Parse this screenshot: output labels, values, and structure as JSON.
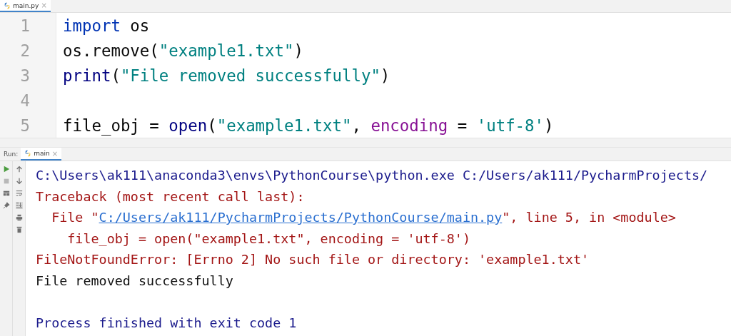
{
  "editor": {
    "tabs": [
      {
        "label": "main.py",
        "selected": true,
        "close": "×"
      }
    ],
    "lines": [
      {
        "number": "1",
        "tokens": [
          {
            "kind": "keyword",
            "text": "import"
          },
          {
            "kind": "plain",
            "text": " os"
          }
        ]
      },
      {
        "number": "2",
        "tokens": [
          {
            "kind": "plain",
            "text": "os.remove("
          },
          {
            "kind": "string",
            "text": "\"example1.txt\""
          },
          {
            "kind": "plain",
            "text": ")"
          }
        ]
      },
      {
        "number": "3",
        "tokens": [
          {
            "kind": "builtin",
            "text": "print"
          },
          {
            "kind": "plain",
            "text": "("
          },
          {
            "kind": "string",
            "text": "\"File removed successfully\""
          },
          {
            "kind": "plain",
            "text": ")"
          }
        ]
      },
      {
        "number": "4"
      },
      {
        "number": "5",
        "tokens": [
          {
            "kind": "plain",
            "text": "file_obj = "
          },
          {
            "kind": "builtin",
            "text": "open"
          },
          {
            "kind": "plain",
            "text": "("
          },
          {
            "kind": "string",
            "text": "\"example1.txt\""
          },
          {
            "kind": "plain",
            "text": ", "
          },
          {
            "kind": "param",
            "text": "encoding"
          },
          {
            "kind": "plain",
            "text": " = "
          },
          {
            "kind": "string",
            "text": "'utf-8'"
          },
          {
            "kind": "plain",
            "text": ")"
          }
        ]
      }
    ]
  },
  "run_panel": {
    "label": "Run:",
    "tabs": [
      {
        "label": "main",
        "selected": true,
        "close": "×"
      }
    ],
    "console": [
      {
        "kind": "command",
        "segments": [
          {
            "kind": "text",
            "text": "C:\\Users\\ak111\\anaconda3\\envs\\PythonCourse\\python.exe C:/Users/ak111/PycharmProjects/"
          }
        ]
      },
      {
        "kind": "error",
        "segments": [
          {
            "kind": "text",
            "text": "Traceback (most recent call last):"
          }
        ]
      },
      {
        "kind": "error",
        "segments": [
          {
            "kind": "text",
            "text": "  File \""
          },
          {
            "kind": "link",
            "text": "C:/Users/ak111/PycharmProjects/PythonCourse/main.py"
          },
          {
            "kind": "text",
            "text": "\", line 5, in <module>"
          }
        ]
      },
      {
        "kind": "error",
        "segments": [
          {
            "kind": "text",
            "text": "    file_obj = open(\"example1.txt\", encoding = 'utf-8')"
          }
        ]
      },
      {
        "kind": "error",
        "segments": [
          {
            "kind": "text",
            "text": "FileNotFoundError: [Errno 2] No such file or directory: 'example1.txt'"
          }
        ]
      },
      {
        "kind": "output",
        "segments": [
          {
            "kind": "text",
            "text": "File removed successfully"
          }
        ]
      },
      {
        "kind": "blank"
      },
      {
        "kind": "command",
        "segments": [
          {
            "kind": "text",
            "text": "Process finished with exit code 1"
          }
        ]
      }
    ]
  }
}
